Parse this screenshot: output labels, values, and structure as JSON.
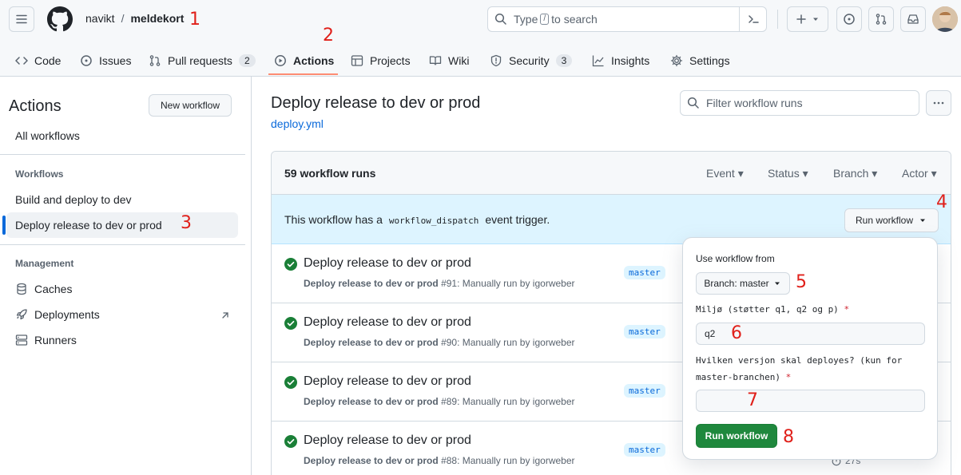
{
  "header": {
    "owner": "navikt",
    "separator": "/",
    "repo": "meldekort",
    "search_prefix": "Type",
    "search_key": "/",
    "search_suffix": "to search"
  },
  "tabs": [
    {
      "label": "Code",
      "icon": "code-icon"
    },
    {
      "label": "Issues",
      "icon": "issue-icon"
    },
    {
      "label": "Pull requests",
      "icon": "pull-request-icon",
      "count": "2"
    },
    {
      "label": "Actions",
      "icon": "play-icon",
      "active": true
    },
    {
      "label": "Projects",
      "icon": "table-icon"
    },
    {
      "label": "Wiki",
      "icon": "book-icon"
    },
    {
      "label": "Security",
      "icon": "shield-icon",
      "count": "3"
    },
    {
      "label": "Insights",
      "icon": "graph-icon"
    },
    {
      "label": "Settings",
      "icon": "gear-icon"
    }
  ],
  "sidebar": {
    "title": "Actions",
    "new_workflow": "New workflow",
    "all_workflows": "All workflows",
    "workflows_heading": "Workflows",
    "workflows": [
      "Build and deploy to dev",
      "Deploy release to dev or prod"
    ],
    "management_heading": "Management",
    "management": [
      "Caches",
      "Deployments",
      "Runners"
    ]
  },
  "main": {
    "title": "Deploy release to dev or prod",
    "file": "deploy.yml",
    "filter_placeholder": "Filter workflow runs",
    "runs_count": "59 workflow runs",
    "filters": [
      "Event",
      "Status",
      "Branch",
      "Actor"
    ],
    "dispatch_pre": "This workflow has a",
    "dispatch_code": "workflow_dispatch",
    "dispatch_post": "event trigger.",
    "run_workflow_label": "Run workflow"
  },
  "runs": [
    {
      "title": "Deploy release to dev or prod",
      "workflow": "Deploy release to dev or prod",
      "number": "#91",
      "by": ": Manually run by igorweber",
      "branch": "master"
    },
    {
      "title": "Deploy release to dev or prod",
      "workflow": "Deploy release to dev or prod",
      "number": "#90",
      "by": ": Manually run by igorweber",
      "branch": "master"
    },
    {
      "title": "Deploy release to dev or prod",
      "workflow": "Deploy release to dev or prod",
      "number": "#89",
      "by": ": Manually run by igorweber",
      "branch": "master"
    },
    {
      "title": "Deploy release to dev or prod",
      "workflow": "Deploy release to dev or prod",
      "number": "#88",
      "by": ": Manually run by igorweber",
      "branch": "master"
    }
  ],
  "last_duration": "27s",
  "popover": {
    "use_from": "Use workflow from",
    "branch_btn": "Branch: master",
    "env_label": "Miljø (støtter q1, q2 og p)",
    "env_value": "q2",
    "version_label_1": "Hvilken versjon skal deployes? (kun for",
    "version_label_2": "master-branchen)",
    "version_value": "",
    "run_btn": "Run workflow",
    "required_mark": "*"
  },
  "annotations": [
    "1",
    "2",
    "3",
    "4",
    "5",
    "6",
    "7",
    "8"
  ],
  "colors": {
    "accent": "#0969da",
    "success": "#1a7f37",
    "tab_underline": "#fd8c73",
    "annotation": "#e0201a"
  }
}
